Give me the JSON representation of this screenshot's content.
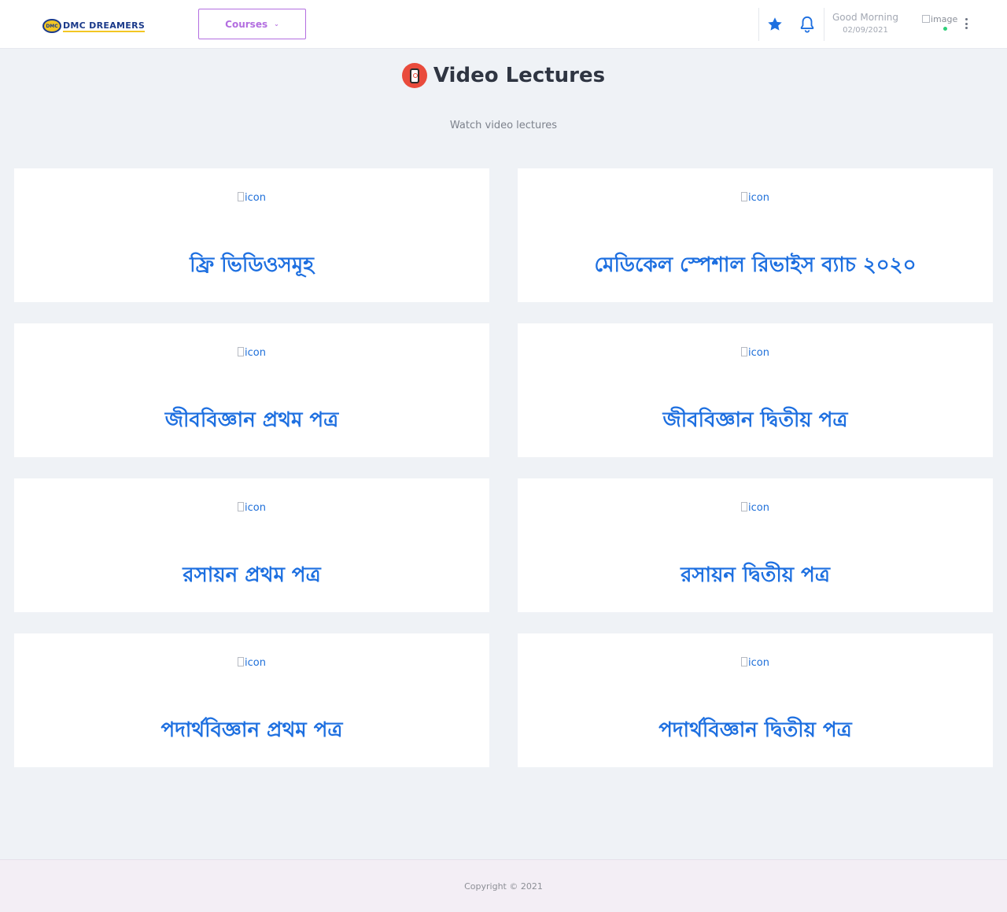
{
  "header": {
    "logo_badge": "DMC",
    "logo_text": "DMC DREAMERS",
    "courses_label": "Courses",
    "greeting": "Good Morning",
    "date": "02/09/2021",
    "avatar_alt": "image",
    "accent_color": "#1d6fe0",
    "courses_color": "#b36ee0"
  },
  "page": {
    "title": "Video Lectures",
    "subtitle": "Watch video lectures"
  },
  "cards": [
    {
      "icon_alt": "icon",
      "title": "ফ্রি ভিডিওসমূহ"
    },
    {
      "icon_alt": "icon",
      "title": "মেডিকেল স্পেশাল রিভাইস ব্যাচ ২০২০"
    },
    {
      "icon_alt": "icon",
      "title": "জীববিজ্ঞান প্রথম পত্র"
    },
    {
      "icon_alt": "icon",
      "title": "জীববিজ্ঞান দ্বিতীয় পত্র"
    },
    {
      "icon_alt": "icon",
      "title": "রসায়ন প্রথম পত্র"
    },
    {
      "icon_alt": "icon",
      "title": "রসায়ন দ্বিতীয় পত্র"
    },
    {
      "icon_alt": "icon",
      "title": "পদার্থবিজ্ঞান প্রথম পত্র"
    },
    {
      "icon_alt": "icon",
      "title": "পদার্থবিজ্ঞান দ্বিতীয় পত্র"
    }
  ],
  "footer": {
    "copyright": "Copyright © 2021"
  }
}
